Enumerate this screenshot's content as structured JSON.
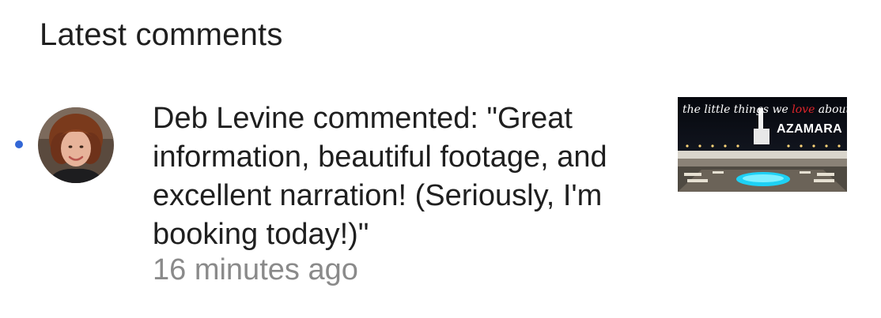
{
  "section": {
    "title": "Latest comments"
  },
  "notification": {
    "message": "Deb Levine commented: \"Great information, beautiful footage, and excellent narration! (Seriously, I'm booking today!)\"",
    "time_ago": "16 minutes ago",
    "unread": true,
    "avatar_icon": "user-avatar",
    "thumbnail": {
      "script_before": "the little things we ",
      "script_love": "love",
      "script_after": " about",
      "brand": "AZAMARA"
    }
  },
  "colors": {
    "unread_dot": "#3367d6",
    "title_text": "#1f1f1f",
    "secondary_text": "#8a8a8a",
    "thumbnail_accent": "#e0252b"
  }
}
